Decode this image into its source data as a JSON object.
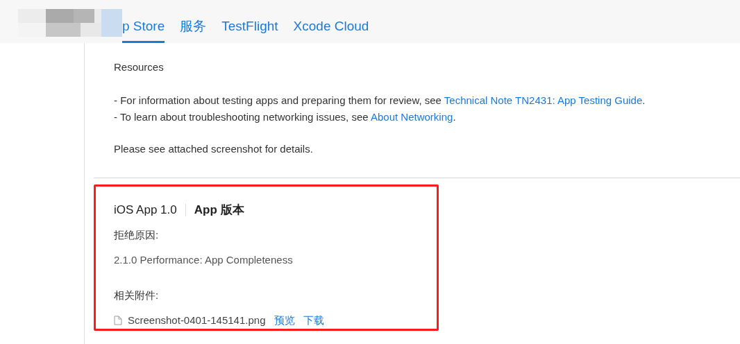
{
  "tabs": [
    {
      "label": "p Store",
      "selected": true
    },
    {
      "label": "服务",
      "selected": false
    },
    {
      "label": "TestFlight",
      "selected": false
    },
    {
      "label": "Xcode Cloud",
      "selected": false
    }
  ],
  "message": {
    "heading": "Resources",
    "lines": [
      {
        "before": "- For information about testing apps and preparing them for review, see ",
        "link": "Technical Note TN2431: App Testing Guide",
        "after": "."
      },
      {
        "before": "- To learn about troubleshooting networking issues, see ",
        "link": "About Networking",
        "after": "."
      }
    ],
    "note": "Please see attached screenshot for details."
  },
  "rejection": {
    "platform": "iOS App 1.0",
    "type": "App 版本",
    "reason_label": "拒绝原因:",
    "reason": "2.1.0 Performance: App Completeness",
    "attachments_label": "相关附件:",
    "attachment": {
      "file": "Screenshot-0401-145141.png",
      "preview": "预览",
      "download": "下载"
    }
  }
}
